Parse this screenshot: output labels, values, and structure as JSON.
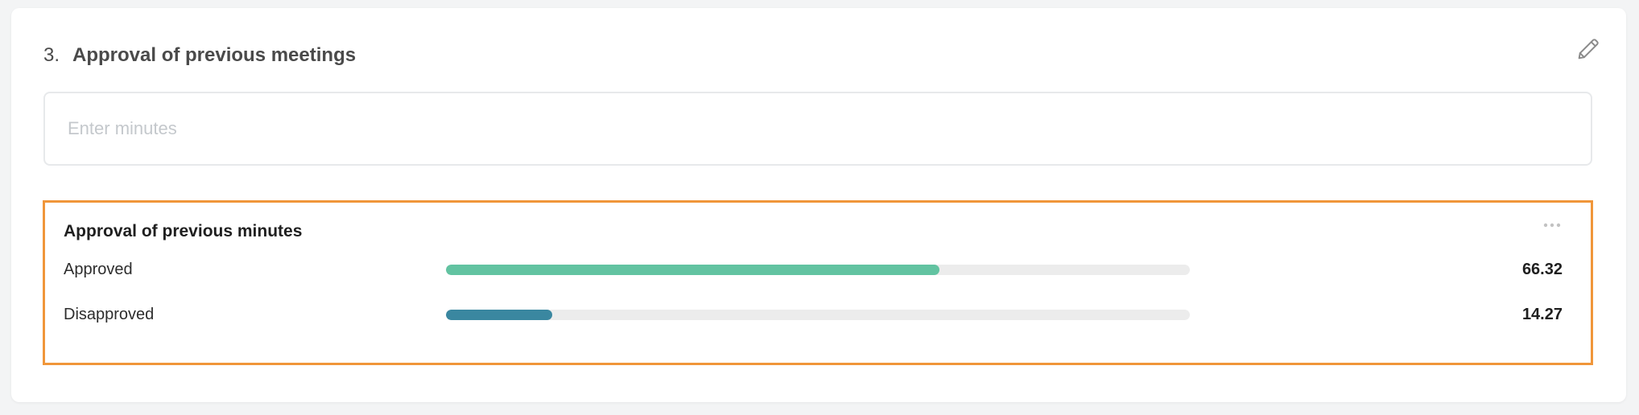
{
  "agenda_item": {
    "number": "3.",
    "title": "Approval of previous meetings"
  },
  "minutes": {
    "placeholder": "Enter minutes",
    "value": ""
  },
  "poll": {
    "title": "Approval of previous minutes",
    "options": [
      {
        "label": "Approved",
        "value": "66.32",
        "percent": 66.32,
        "color": "#62c3a1"
      },
      {
        "label": "Disapproved",
        "value": "14.27",
        "percent": 14.27,
        "color": "#3a87a0"
      }
    ]
  },
  "colors": {
    "poll_highlight_border": "#f0963a",
    "bar_track": "#ececec"
  },
  "icons": {
    "edit": "pencil-icon",
    "more": "more-horizontal-icon"
  }
}
